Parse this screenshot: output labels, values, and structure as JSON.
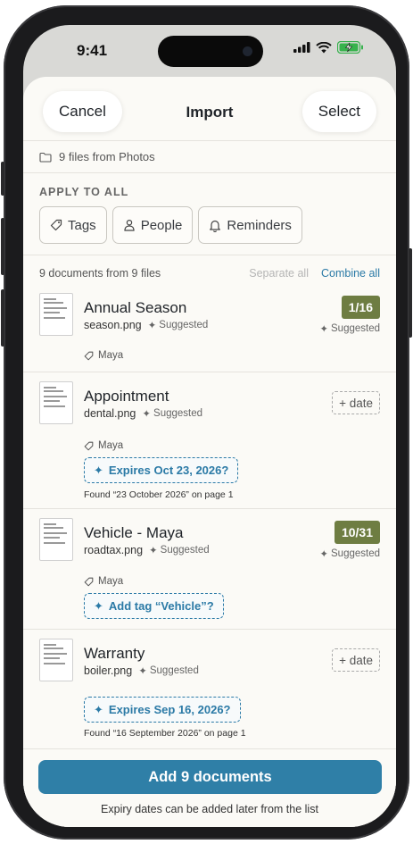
{
  "status_bar": {
    "time": "9:41"
  },
  "nav": {
    "cancel_label": "Cancel",
    "title": "Import",
    "select_label": "Select"
  },
  "source": {
    "label": "9 files from Photos"
  },
  "apply_all": {
    "title": "APPLY TO ALL",
    "chips": [
      {
        "label": "Tags",
        "icon": "tag-icon"
      },
      {
        "label": "People",
        "icon": "person-icon"
      },
      {
        "label": "Reminders",
        "icon": "bell-icon"
      }
    ]
  },
  "list": {
    "summary": "9 documents from 9 files",
    "separate_label": "Separate all",
    "combine_label": "Combine all"
  },
  "documents": [
    {
      "title": "Annual Season",
      "file": "season.png",
      "suggested": "Suggested",
      "date": "1/16",
      "date_suggested": "Suggested",
      "tag": "Maya"
    },
    {
      "title": "Appointment",
      "file": "dental.png",
      "suggested": "Suggested",
      "add_date": "+ date",
      "tag": "Maya",
      "suggestion": "Expires Oct 23, 2026?",
      "found": "Found “23 October 2026” on page 1"
    },
    {
      "title": "Vehicle - Maya",
      "file": "roadtax.png",
      "suggested": "Suggested",
      "date": "10/31",
      "date_suggested": "Suggested",
      "tag": "Maya",
      "suggestion": "Add tag “Vehicle”?"
    },
    {
      "title": "Warranty",
      "file": "boiler.png",
      "suggested": "Suggested",
      "add_date": "+ date",
      "suggestion": "Expires Sep 16, 2026?",
      "found": "Found “16 September 2026” on page 1"
    }
  ],
  "footer": {
    "primary_label": "Add 9 documents",
    "note": "Expiry dates can be added later from the list"
  },
  "colors": {
    "accent": "#2f7fa7",
    "date_badge": "#6e7d42",
    "background": "#fbfaf6"
  }
}
